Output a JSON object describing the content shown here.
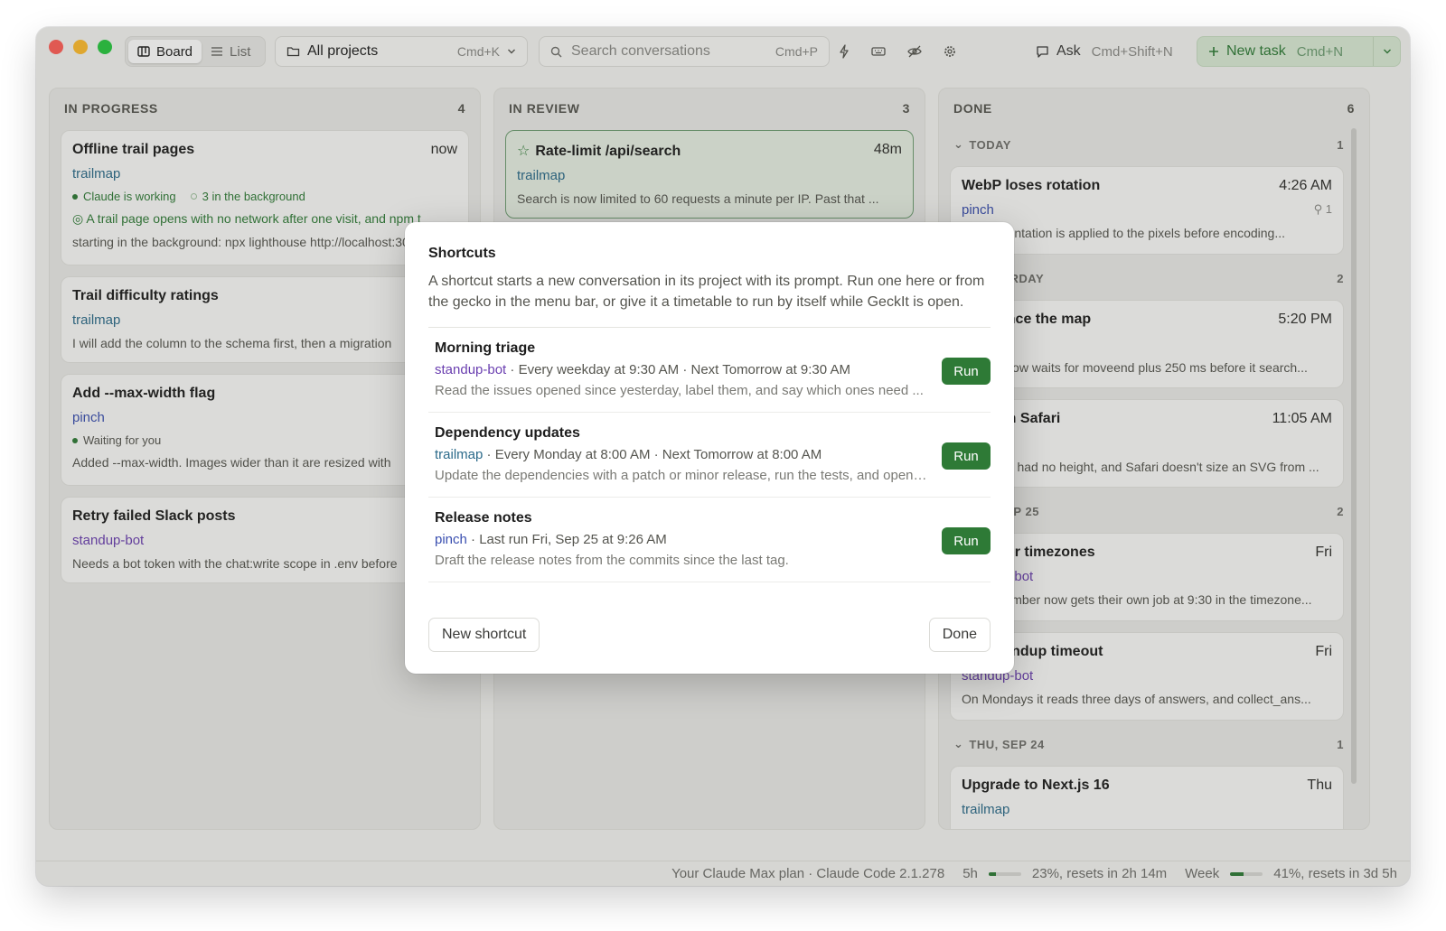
{
  "toolbar": {
    "view_board": "Board",
    "view_list": "List",
    "projects_label": "All projects",
    "projects_shortcut": "Cmd+K",
    "search_placeholder": "Search conversations",
    "search_shortcut": "Cmd+P",
    "ask_label": "Ask",
    "ask_shortcut": "Cmd+Shift+N",
    "new_task_label": "New task",
    "new_task_shortcut": "Cmd+N"
  },
  "columns": {
    "in_progress": {
      "title": "IN PROGRESS",
      "count": "4",
      "cards": [
        {
          "title": "Offline trail pages",
          "time": "now",
          "project": "trailmap",
          "status": "Claude is working",
          "background": "3 in the background",
          "snippet1": "A trail page opens with no network after one visit, and npm t",
          "snippet2": "starting in the background: npx lighthouse http://localhost:3000"
        },
        {
          "title": "Trail difficulty ratings",
          "project": "trailmap",
          "snippet": "I will add the column to the schema first, then a migration"
        },
        {
          "title": "Add --max-width flag",
          "project": "pinch",
          "status": "Waiting for you",
          "snippet": "Added --max-width. Images wider than it are resized with"
        },
        {
          "title": "Retry failed Slack posts",
          "project": "standup-bot",
          "snippet": "Needs a bot token with the chat:write scope in .env before"
        }
      ]
    },
    "in_review": {
      "title": "IN REVIEW",
      "count": "3",
      "cards": [
        {
          "title": "Rate-limit /api/search",
          "time": "48m",
          "project": "trailmap",
          "snippet": "Search is now limited to 60 requests a minute per IP. Past that ..."
        }
      ]
    },
    "done": {
      "title": "DONE",
      "count": "6",
      "groups": [
        {
          "label": "TODAY",
          "count": "1"
        },
        {
          "label": "YESTERDAY",
          "count": "2"
        },
        {
          "label": "FRI, SEP 25",
          "count": "2"
        },
        {
          "label": "THU, SEP 24",
          "count": "1"
        }
      ],
      "cards": [
        {
          "title": "WebP loses rotation",
          "time": "4:26 AM",
          "project": "pinch",
          "links": "1",
          "snippet": "EXIF orientation is applied to the pixels before encoding..."
        },
        {
          "title": "Debounce the map",
          "time": "5:20 PM",
          "snippet": "Search now waits for moveend plus 250 ms before it search..."
        },
        {
          "title": "Chart in Safari",
          "time": "11:05 AM",
          "snippet": "The SVG had no height, and Safari doesn't size an SVG from ..."
        },
        {
          "title": "Per-user timezones",
          "time": "Fri",
          "project": "standup-bot",
          "snippet": "Each member now gets their own job at 9:30 in the timezone..."
        },
        {
          "title": "Fix /standup timeout",
          "time": "Fri",
          "project": "standup-bot",
          "snippet": "On Mondays it reads three days of answers, and collect_ans..."
        },
        {
          "title": "Upgrade to Next.js 16",
          "time": "Thu",
          "project": "trailmap"
        }
      ]
    }
  },
  "statusbar": {
    "plan": "Your Claude Max plan · Claude Code 2.1.278",
    "five_h_label": "5h",
    "five_h_percent": 23,
    "five_h_text": "23%, resets in 2h 14m",
    "week_label": "Week",
    "week_percent": 41,
    "week_text": "41%, resets in 3d 5h"
  },
  "modal": {
    "title": "Shortcuts",
    "description": "A shortcut starts a new conversation in its project with its prompt. Run one here or from the gecko in the menu bar, or give it a timetable to run by itself while GeckIt is open.",
    "shortcuts": [
      {
        "name": "Morning triage",
        "project": "standup-bot",
        "schedule": " · Every weekday at 9:30 AM · Next Tomorrow at 9:30 AM",
        "prompt": "Read the issues opened since yesterday, label them, and say which ones need ...",
        "run_label": "Run"
      },
      {
        "name": "Dependency updates",
        "project": "trailmap",
        "schedule": " · Every Monday at 8:00 AM · Next Tomorrow at 8:00 AM",
        "prompt": "Update the dependencies with a patch or minor release, run the tests, and open ...",
        "run_label": "Run"
      },
      {
        "name": "Release notes",
        "project": "pinch",
        "schedule": " · Last run Fri, Sep 25 at 9:26 AM",
        "prompt": "Draft the release notes from the commits since the last tag.",
        "run_label": "Run"
      }
    ],
    "new_shortcut_label": "New shortcut",
    "done_label": "Done"
  },
  "colors": {
    "accent_green": "#2e7a36",
    "project_trailmap": "#2b6a8a",
    "project_pinch": "#3a4fb0",
    "project_standup": "#6a3fb0"
  }
}
